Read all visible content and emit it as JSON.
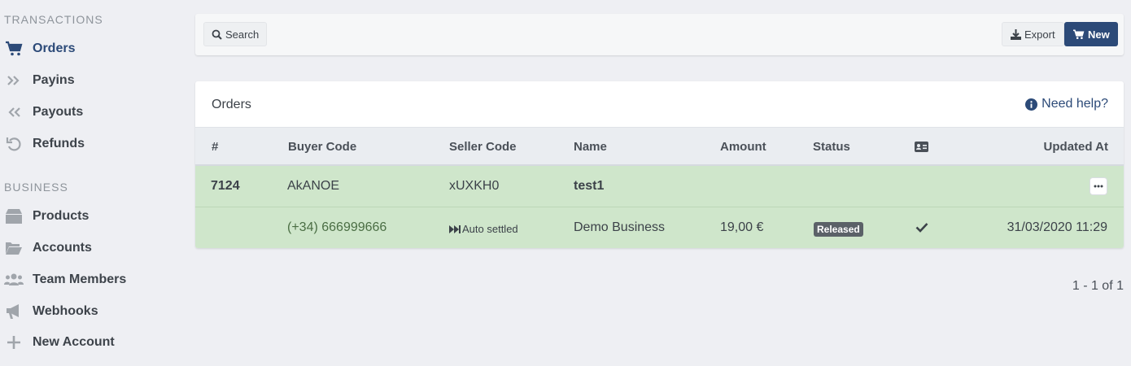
{
  "sidebar": {
    "sections": [
      {
        "title": "TRANSACTIONS",
        "items": [
          {
            "label": "Orders",
            "icon": "cart-icon",
            "active": true
          },
          {
            "label": "Payins",
            "icon": "double-chevron-right-icon"
          },
          {
            "label": "Payouts",
            "icon": "double-chevron-left-icon"
          },
          {
            "label": "Refunds",
            "icon": "undo-icon"
          }
        ]
      },
      {
        "title": "BUSINESS",
        "items": [
          {
            "label": "Products",
            "icon": "box-icon"
          },
          {
            "label": "Accounts",
            "icon": "folder-open-icon"
          },
          {
            "label": "Team Members",
            "icon": "users-icon"
          },
          {
            "label": "Webhooks",
            "icon": "megaphone-icon"
          },
          {
            "label": "New Account",
            "icon": "plus-icon"
          }
        ]
      }
    ]
  },
  "toolbar": {
    "search_label": "Search",
    "export_label": "Export",
    "new_label": "New"
  },
  "panel": {
    "title": "Orders",
    "help_label": "Need help?"
  },
  "table": {
    "columns": [
      "#",
      "Buyer Code",
      "Seller Code",
      "Name",
      "Amount",
      "Status",
      "id-card-icon",
      "Updated At"
    ],
    "rows": [
      {
        "id": "7124",
        "buyer_code": "AkANOE",
        "seller_code": "xUXKH0",
        "name": "test1",
        "buyer_phone": "(+34) 666999666",
        "settlement": "Auto settled",
        "business": "Demo Business",
        "amount": "19,00 €",
        "status": "Released",
        "verified": true,
        "updated_at": "31/03/2020 11:29"
      }
    ]
  },
  "pagination": "1 - 1 of 1",
  "colors": {
    "accent": "#2c4a78",
    "row_highlight": "#cfe6cb",
    "background": "#eeeff3"
  }
}
